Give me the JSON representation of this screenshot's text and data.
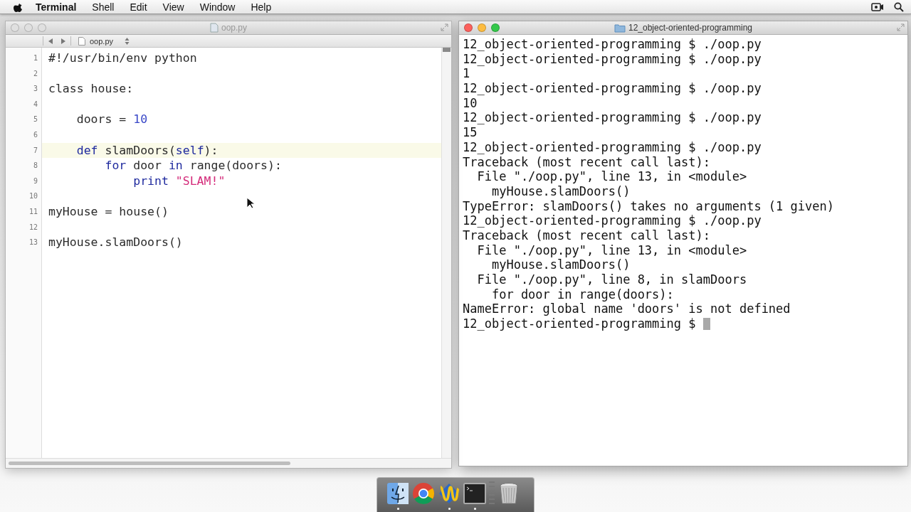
{
  "menubar": {
    "app_name": "Terminal",
    "menus": [
      "Shell",
      "Edit",
      "View",
      "Window",
      "Help"
    ]
  },
  "editor": {
    "title": "oop.py",
    "file_tab": "oop.py",
    "lines": [
      {
        "number": "1",
        "current": false,
        "tokens": [
          {
            "kind": "plain",
            "text": "#!/usr/bin/env python"
          }
        ]
      },
      {
        "number": "2",
        "current": false
      },
      {
        "number": "3",
        "current": false,
        "tokens": [
          {
            "kind": "plain",
            "text": "class house:"
          }
        ]
      },
      {
        "number": "4",
        "current": false
      },
      {
        "number": "5",
        "current": false,
        "tokens": [
          {
            "kind": "plain",
            "text": "    doors = "
          },
          {
            "kind": "number",
            "text": "10"
          }
        ]
      },
      {
        "number": "6",
        "current": false
      },
      {
        "number": "7",
        "current": true,
        "tokens": [
          {
            "kind": "keyword",
            "text": "    def"
          },
          {
            "kind": "plain",
            "text": " slamDoors("
          },
          {
            "kind": "keyword",
            "text": "self"
          },
          {
            "kind": "plain",
            "text": "):"
          }
        ]
      },
      {
        "number": "8",
        "current": false,
        "tokens": [
          {
            "kind": "keyword",
            "text": "        for"
          },
          {
            "kind": "plain",
            "text": " door "
          },
          {
            "kind": "keyword",
            "text": "in"
          },
          {
            "kind": "plain",
            "text": " range(doors):"
          }
        ]
      },
      {
        "number": "9",
        "current": false,
        "tokens": [
          {
            "kind": "keyword",
            "text": "            print "
          },
          {
            "kind": "string",
            "text": "\"SLAM!\""
          }
        ]
      },
      {
        "number": "10",
        "current": false
      },
      {
        "number": "11",
        "current": false,
        "tokens": [
          {
            "kind": "plain",
            "text": "myHouse = house()"
          }
        ]
      },
      {
        "number": "12",
        "current": false
      },
      {
        "number": "13",
        "current": false,
        "tokens": [
          {
            "kind": "plain",
            "text": "myHouse.slamDoors()"
          }
        ]
      }
    ]
  },
  "terminal": {
    "title": "12_object-oriented-programming",
    "lines": [
      "12_object-oriented-programming $ ./oop.py",
      "12_object-oriented-programming $ ./oop.py",
      "1",
      "12_object-oriented-programming $ ./oop.py",
      "10",
      "12_object-oriented-programming $ ./oop.py",
      "15",
      "12_object-oriented-programming $ ./oop.py",
      "Traceback (most recent call last):",
      "  File \"./oop.py\", line 13, in <module>",
      "    myHouse.slamDoors()",
      "TypeError: slamDoors() takes no arguments (1 given)",
      "12_object-oriented-programming $ ./oop.py",
      "Traceback (most recent call last):",
      "  File \"./oop.py\", line 13, in <module>",
      "    myHouse.slamDoors()",
      "  File \"./oop.py\", line 8, in slamDoors",
      "    for door in range(doors):",
      "NameError: global name 'doors' is not defined",
      "12_object-oriented-programming $"
    ]
  },
  "dock": {
    "items": [
      {
        "kind": "finder",
        "running": true
      },
      {
        "kind": "browser",
        "running": false
      },
      {
        "kind": "editor",
        "running": true
      },
      {
        "kind": "terminal",
        "running": true
      },
      {
        "kind": "trash",
        "running": false
      }
    ]
  }
}
